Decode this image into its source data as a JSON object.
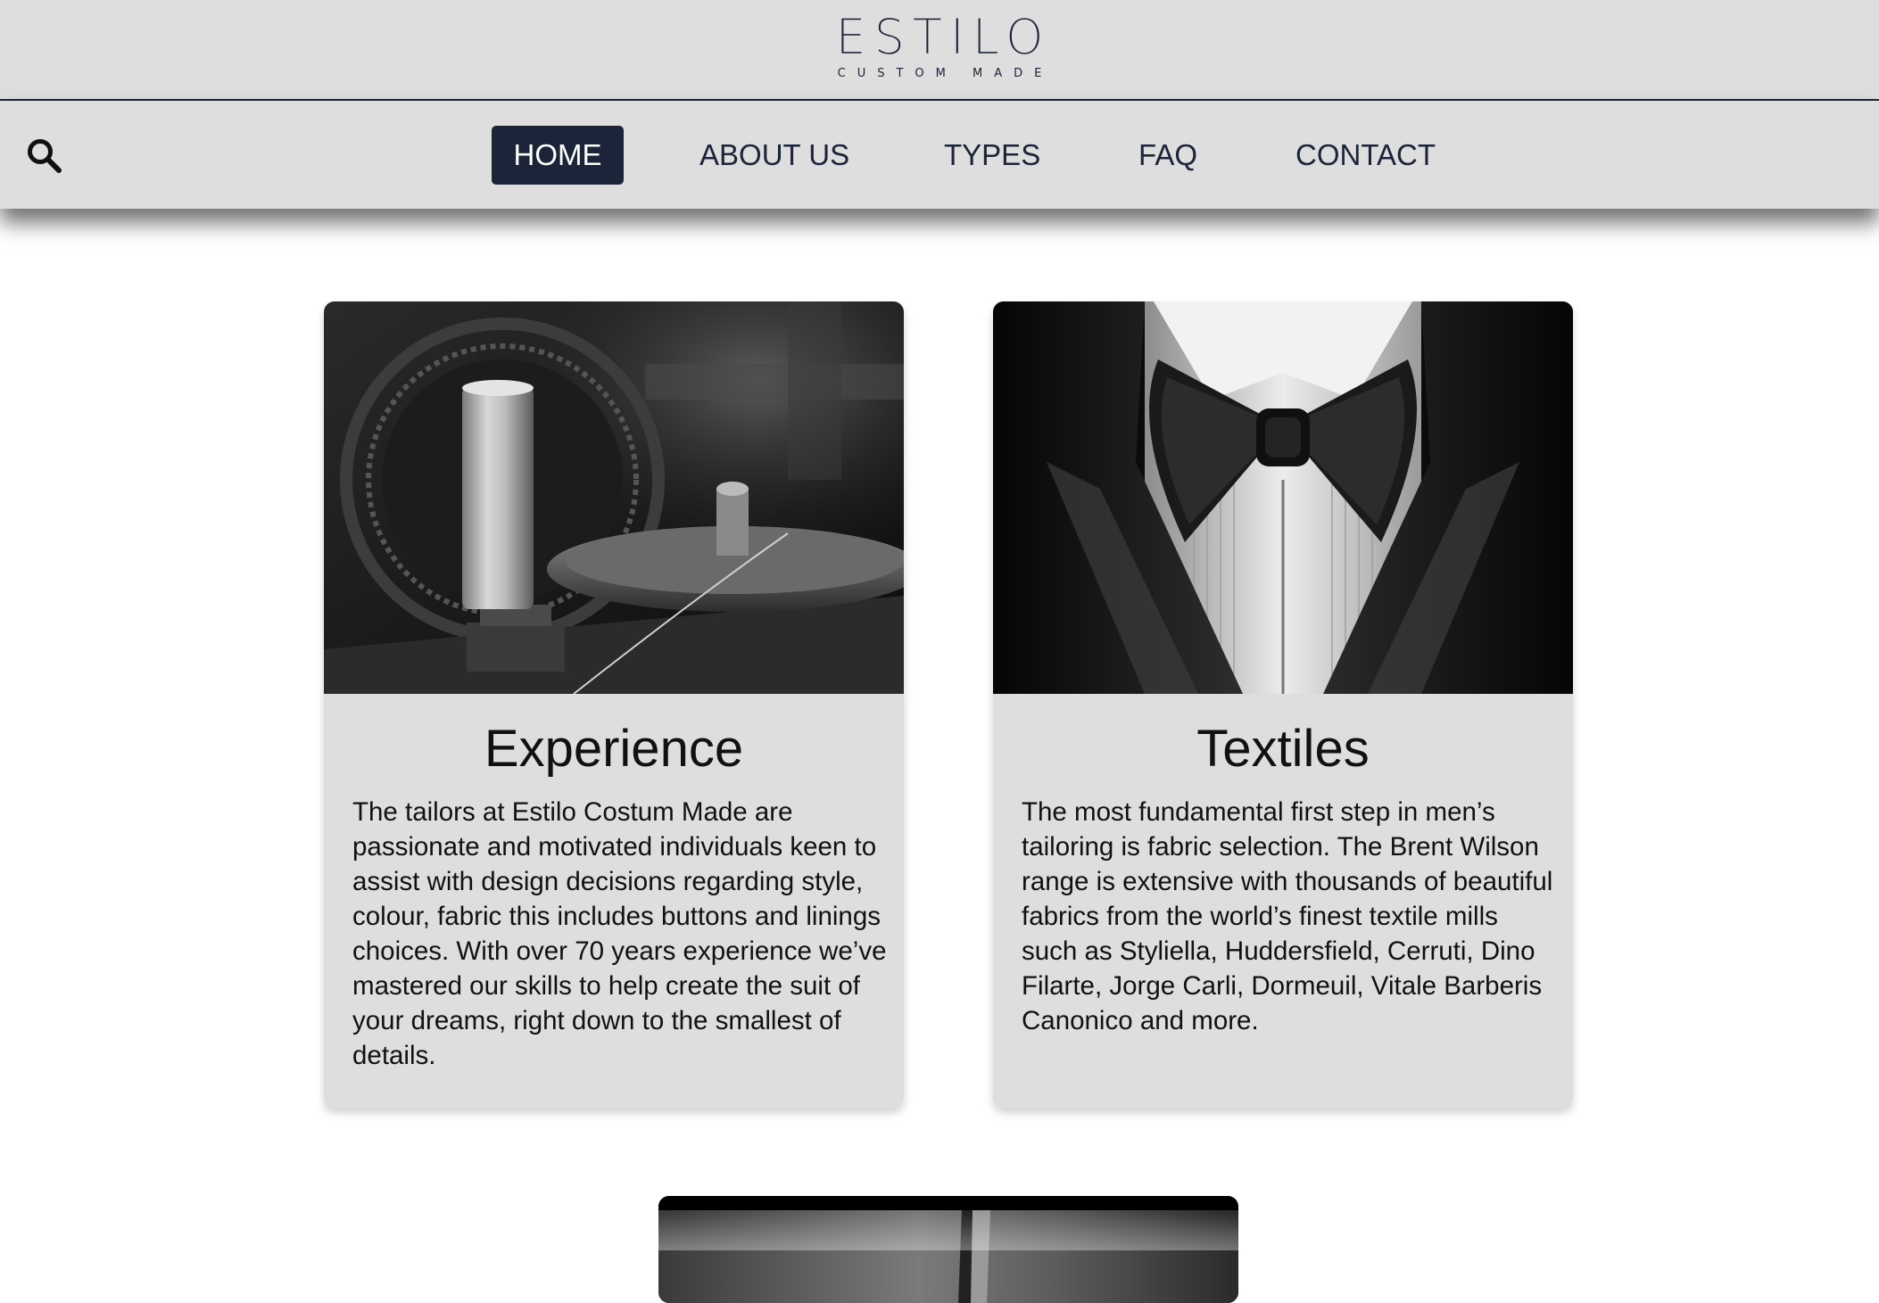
{
  "brand": {
    "title": "ESTILO",
    "subtitle": "CUSTOM MADE"
  },
  "nav": {
    "search_icon": "search-icon",
    "items": [
      {
        "label": "HOME",
        "active": true
      },
      {
        "label": "ABOUT US",
        "active": false
      },
      {
        "label": "TYPES",
        "active": false
      },
      {
        "label": "FAQ",
        "active": false
      },
      {
        "label": "CONTACT",
        "active": false
      }
    ]
  },
  "cards": [
    {
      "image": "sewing-machine-spool-photo",
      "title": "Experience",
      "text": "The tailors at Estilo Costum Made are passionate and motivated individuals keen to assist with design decisions regarding style, colour, fabric this includes buttons and linings choices. With over 70 years experience we’ve mastered our skills to help create the suit of your dreams, right down to the smallest of details."
    },
    {
      "image": "tuxedo-bow-tie-photo",
      "title": "Textiles",
      "text": "The most fundamental first step in men’s tailoring is fabric selection. The Brent Wilson range is extensive with thousands of beautiful fabrics from the world’s finest textile mills such as Styliella, Huddersfield, Cerruti, Dino Filarte, Jorge Carli, Dormeuil, Vitale Barberis Canonico and more."
    },
    {
      "image": "tailoring-photo"
    }
  ],
  "colors": {
    "navy": "#1b2438",
    "bar": "#dedede",
    "card": "#dedede"
  }
}
